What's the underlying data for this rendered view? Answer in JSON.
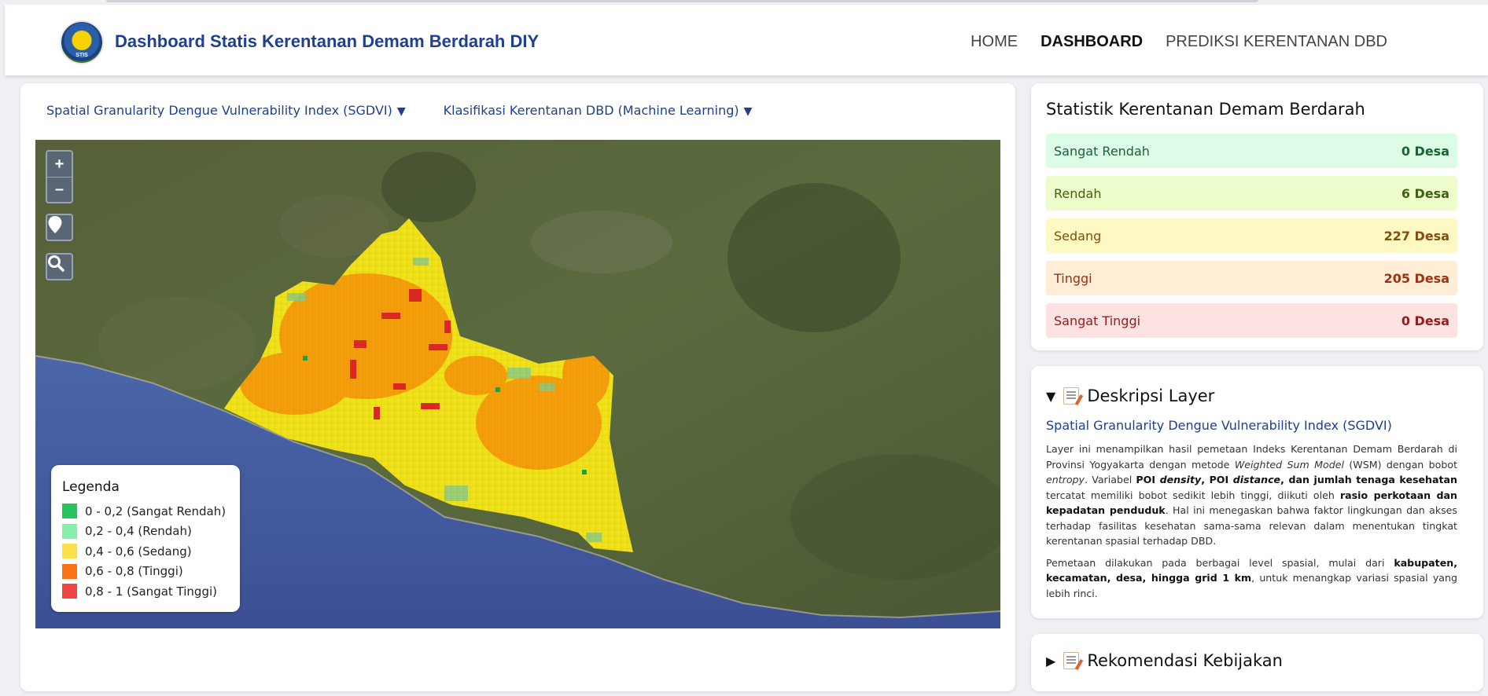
{
  "header": {
    "logo_text": "STIS",
    "title": "Dashboard Statis Kerentanan Demam Berdarah DIY",
    "nav": [
      {
        "label": "HOME",
        "active": false
      },
      {
        "label": "DASHBOARD",
        "active": true
      },
      {
        "label": "PREDIKSI KERENTANAN DBD",
        "active": false
      }
    ]
  },
  "map_panel": {
    "layer_selectors": [
      {
        "label": "Spatial Granularity Dengue Vulnerability Index (SGDVI)",
        "caret": "▼"
      },
      {
        "label": "Klasifikasi Kerentanan DBD (Machine Learning)",
        "caret": "▼"
      }
    ],
    "zoom_in": "+",
    "zoom_out": "–",
    "legend": {
      "title": "Legenda",
      "items": [
        {
          "label": "0 - 0,2 (Sangat Rendah)",
          "color": "#22c55e"
        },
        {
          "label": "0,2 - 0,4 (Rendah)",
          "color": "#86efac"
        },
        {
          "label": "0,4 - 0,6 (Sedang)",
          "color": "#fde047"
        },
        {
          "label": "0,6 - 0,8 (Tinggi)",
          "color": "#f97316"
        },
        {
          "label": "0,8 - 1 (Sangat Tinggi)",
          "color": "#ef4444"
        }
      ]
    }
  },
  "stats": {
    "title": "Statistik Kerentanan Demam Berdarah",
    "rows": [
      {
        "label": "Sangat Rendah",
        "value": "0 Desa",
        "bg": "#dcfce7",
        "fg": "#166534"
      },
      {
        "label": "Rendah",
        "value": "6 Desa",
        "bg": "#ecfccb",
        "fg": "#3f6212"
      },
      {
        "label": "Sedang",
        "value": "227 Desa",
        "bg": "#fef9c3",
        "fg": "#854d0e"
      },
      {
        "label": "Tinggi",
        "value": "205 Desa",
        "bg": "#ffedd5",
        "fg": "#9a3412"
      },
      {
        "label": "Sangat Tinggi",
        "value": "0 Desa",
        "bg": "#fee2e2",
        "fg": "#991b1b"
      }
    ]
  },
  "description": {
    "toggle": "▼",
    "title": "Deskripsi Layer",
    "subtitle": "Spatial Granularity Dengue Vulnerability Index (SGDVI)",
    "p1": [
      "Layer ini menampilkan hasil pemetaan Indeks Kerentanan Demam Berdarah di Provinsi Yogyakarta dengan metode ",
      "Weighted Sum Model",
      " (WSM) dengan bobot ",
      "entropy",
      ". Variabel ",
      "POI ",
      "density",
      ", POI ",
      "distance",
      ", dan jumlah tenaga kesehatan",
      " tercatat memiliki bobot sedikit lebih tinggi, diikuti oleh ",
      "rasio perkotaan dan kepadatan penduduk",
      ". Hal ini menegaskan bahwa faktor lingkungan dan akses terhadap fasilitas kesehatan sama-sama relevan dalam menentukan tingkat kerentanan spasial terhadap DBD."
    ],
    "p2": [
      "Pemetaan dilakukan pada berbagai level spasial, mulai dari ",
      "kabupaten, kecamatan, desa, hingga grid 1 km",
      ", untuk menangkap variasi spasial yang lebih rinci."
    ]
  },
  "recommendation": {
    "toggle": "▶",
    "title": "Rekomendasi Kebijakan"
  }
}
